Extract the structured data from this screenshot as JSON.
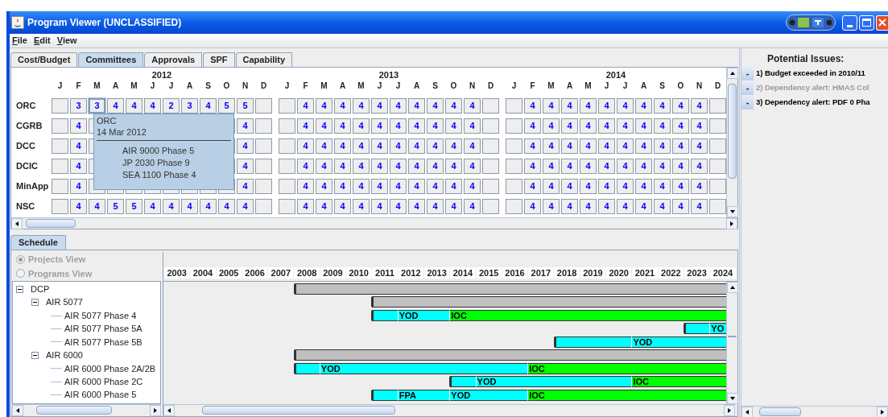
{
  "window": {
    "title": "Program Viewer (UNCLASSIFIED)"
  },
  "menu": [
    "File",
    "Edit",
    "View"
  ],
  "tabs": [
    {
      "label": "Cost/Budget",
      "selected": false
    },
    {
      "label": "Committees",
      "selected": true
    },
    {
      "label": "Approvals",
      "selected": false
    },
    {
      "label": "SPF",
      "selected": false
    },
    {
      "label": "Capability",
      "selected": false
    }
  ],
  "committees": {
    "years": [
      {
        "year": "2012",
        "months": [
          "J",
          "F",
          "M",
          "A",
          "M",
          "J",
          "J",
          "A",
          "S",
          "O",
          "N",
          "D"
        ]
      },
      {
        "year": "2013",
        "months": [
          "J",
          "F",
          "M",
          "A",
          "M",
          "J",
          "J",
          "A",
          "S",
          "O",
          "N",
          "D"
        ]
      },
      {
        "year": "2014",
        "months": [
          "J",
          "F",
          "M",
          "A",
          "M",
          "J",
          "J",
          "A",
          "S",
          "O",
          "N",
          "D"
        ]
      }
    ],
    "rows": [
      {
        "name": "ORC",
        "cells": [
          [
            null,
            "3",
            {
              "value": "3",
              "selected": true
            },
            "4",
            "4",
            "4",
            "2",
            "3",
            "4",
            "5",
            "5",
            null
          ],
          [
            null,
            "4",
            "4",
            "4",
            "4",
            "4",
            "4",
            "4",
            "4",
            "4",
            "4",
            null
          ],
          [
            null,
            "4",
            "4",
            "4",
            "4",
            "4",
            "4",
            "4",
            "4",
            "4",
            "4",
            null
          ]
        ]
      },
      {
        "name": "CGRB",
        "cells": [
          [
            null,
            "4",
            null,
            null,
            null,
            null,
            null,
            null,
            null,
            null,
            "4",
            null
          ],
          [
            null,
            "4",
            "4",
            "4",
            "4",
            "4",
            "4",
            "4",
            "4",
            "4",
            "4",
            null
          ],
          [
            null,
            "4",
            "4",
            "4",
            "4",
            "4",
            "4",
            "4",
            "4",
            "4",
            "4",
            null
          ]
        ]
      },
      {
        "name": "DCC",
        "cells": [
          [
            null,
            "4",
            null,
            null,
            null,
            null,
            null,
            null,
            null,
            null,
            "4",
            null
          ],
          [
            null,
            "4",
            "4",
            "4",
            "4",
            "4",
            "4",
            "4",
            "4",
            "4",
            "4",
            null
          ],
          [
            null,
            "4",
            "4",
            "4",
            "4",
            "4",
            "4",
            "4",
            "4",
            "4",
            "4",
            null
          ]
        ]
      },
      {
        "name": "DCIC",
        "cells": [
          [
            null,
            "4",
            null,
            null,
            null,
            null,
            null,
            null,
            null,
            null,
            "4",
            null
          ],
          [
            null,
            "4",
            "4",
            "4",
            "4",
            "4",
            "4",
            "4",
            "4",
            "4",
            "4",
            null
          ],
          [
            null,
            "4",
            "4",
            "4",
            "4",
            "4",
            "4",
            "4",
            "4",
            "4",
            "4",
            null
          ]
        ]
      },
      {
        "name": "MinApp",
        "cells": [
          [
            null,
            "4",
            null,
            null,
            null,
            null,
            null,
            null,
            null,
            null,
            "4",
            null
          ],
          [
            null,
            "4",
            "4",
            "4",
            "4",
            "4",
            "4",
            "4",
            "4",
            "4",
            "4",
            null
          ],
          [
            null,
            "4",
            "4",
            "4",
            "4",
            "4",
            "4",
            "4",
            "4",
            "4",
            "4",
            null
          ]
        ]
      },
      {
        "name": "NSC",
        "cells": [
          [
            null,
            "4",
            "4",
            "5",
            "5",
            "4",
            "4",
            "4",
            "4",
            "4",
            "4",
            null
          ],
          [
            null,
            "4",
            "4",
            "4",
            "4",
            "4",
            "4",
            "4",
            "4",
            "4",
            "4",
            null
          ],
          [
            null,
            "4",
            "4",
            "4",
            "4",
            "4",
            "4",
            "4",
            "4",
            "4",
            "4",
            null
          ]
        ]
      }
    ],
    "tooltip": {
      "title": "ORC",
      "date": "14 Mar 2012",
      "items": [
        "AIR 9000 Phase 5",
        "JP 2030 Phase 9",
        "SEA 1100 Phase 4"
      ]
    }
  },
  "issues": {
    "title": "Potential Issues:",
    "items": [
      {
        "button": "-",
        "text": "1) Budget exceeded in 2010/11",
        "disabled": false
      },
      {
        "button": "-",
        "text": "2) Dependency alert: HMAS Col",
        "disabled": true
      },
      {
        "button": "-",
        "text": "3) Dependency alert: PDF 0 Pha",
        "disabled": false
      }
    ]
  },
  "schedule": {
    "tab": {
      "label": "Schedule",
      "selected": true
    },
    "views": [
      {
        "label": "Projects View",
        "selected": true,
        "disabled": true
      },
      {
        "label": "Programs View",
        "selected": false,
        "disabled": true
      }
    ],
    "tree": [
      {
        "label": "DCP",
        "expanded": true,
        "children": [
          {
            "label": "AIR 5077",
            "expanded": true,
            "children": [
              {
                "label": "AIR 5077 Phase 4"
              },
              {
                "label": "AIR 5077 Phase 5A"
              },
              {
                "label": "AIR 5077 Phase 5B"
              }
            ]
          },
          {
            "label": "AIR 6000",
            "expanded": true,
            "children": [
              {
                "label": "AIR 6000 Phase 2A/2B"
              },
              {
                "label": "AIR 6000 Phase 2C"
              },
              {
                "label": "AIR 6000 Phase 5"
              }
            ]
          }
        ]
      }
    ],
    "years": [
      "2003",
      "2004",
      "2005",
      "2006",
      "2007",
      "2008",
      "2009",
      "2010",
      "2011",
      "2012",
      "2013",
      "2014",
      "2015",
      "2016",
      "2017",
      "2018",
      "2019",
      "2020",
      "2021",
      "2022",
      "2023",
      "2024"
    ],
    "rows": [
      {
        "kind": "summary",
        "cells": [
          null,
          null,
          null,
          null,
          null,
          {
            "color": "#c0c0c0"
          }
        ]
      },
      {
        "kind": "summary",
        "cells": [
          null,
          null,
          null,
          null,
          null,
          null,
          null,
          null,
          {
            "color": "#c0c0c0"
          }
        ]
      },
      {
        "kind": "phase",
        "cells": [
          null,
          null,
          null,
          null,
          null,
          null,
          null,
          null,
          {
            "color": "#00ffff"
          },
          {
            "color": "#00ffff",
            "label": "YOD"
          },
          null,
          {
            "color": "#00ff00",
            "label": "IOC"
          }
        ]
      },
      {
        "kind": "phase",
        "cells": [
          null,
          null,
          null,
          null,
          null,
          null,
          null,
          null,
          null,
          null,
          null,
          null,
          null,
          null,
          null,
          null,
          null,
          null,
          null,
          null,
          {
            "color": "#00ffff"
          },
          {
            "color": "#00ffff",
            "label": "YO"
          }
        ]
      },
      {
        "kind": "phase",
        "cells": [
          null,
          null,
          null,
          null,
          null,
          null,
          null,
          null,
          null,
          null,
          null,
          null,
          null,
          null,
          null,
          {
            "color": "#00ffff"
          },
          null,
          null,
          {
            "color": "#00ffff",
            "label": "YOD"
          }
        ]
      },
      {
        "kind": "summary",
        "cells": [
          null,
          null,
          null,
          null,
          null,
          {
            "color": "#c0c0c0"
          }
        ]
      },
      {
        "kind": "phase",
        "cells": [
          null,
          null,
          null,
          null,
          null,
          {
            "color": "#00ffff"
          },
          {
            "color": "#00ffff",
            "label": "YOD"
          },
          null,
          null,
          null,
          null,
          null,
          null,
          null,
          {
            "color": "#00ff00",
            "label": "IOC"
          }
        ]
      },
      {
        "kind": "phase",
        "cells": [
          null,
          null,
          null,
          null,
          null,
          null,
          null,
          null,
          null,
          null,
          null,
          {
            "color": "#00ffff"
          },
          {
            "color": "#00ffff",
            "label": "YOD"
          },
          null,
          null,
          null,
          null,
          null,
          {
            "color": "#00ff00",
            "label": "IOC"
          }
        ]
      },
      {
        "kind": "phase",
        "cells": [
          null,
          null,
          null,
          null,
          null,
          null,
          null,
          null,
          {
            "color": "#00ffff"
          },
          {
            "color": "#00ffff",
            "label": "FPA"
          },
          null,
          {
            "color": "#00ffff",
            "label": "YOD"
          },
          null,
          null,
          {
            "color": "#00ff00",
            "label": "IOC"
          }
        ]
      }
    ]
  }
}
